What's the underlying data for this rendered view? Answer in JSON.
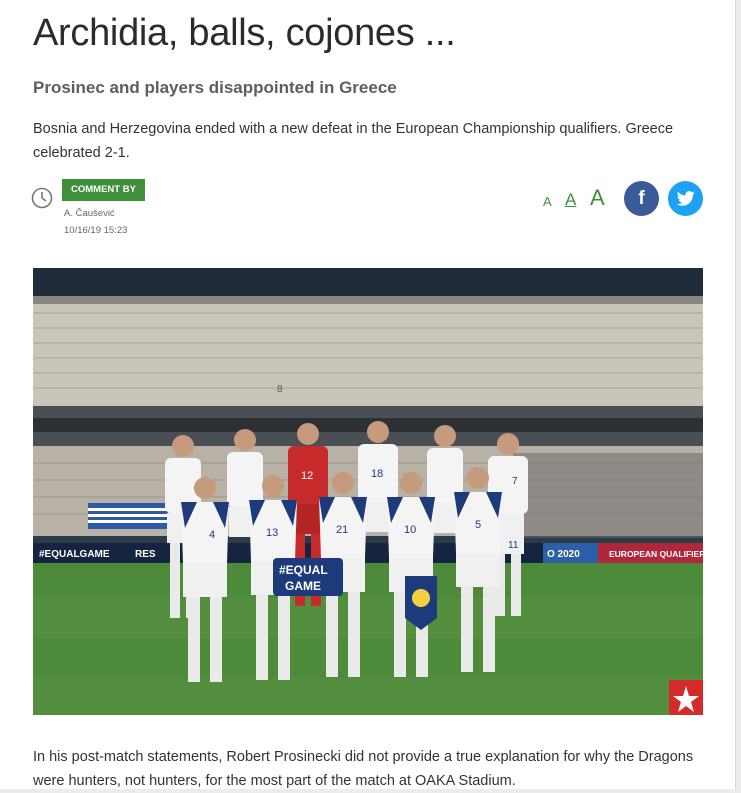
{
  "article": {
    "title": "Archidia, balls, cojones ...",
    "subtitle": "Prosinec and players disappointed in Greece",
    "lead": "Bosnia and Herzegovina ended with a new defeat in the European Championship qualifiers. Greece celebrated 2-1.",
    "comment_label": "COMMENT BY",
    "author": "A. Čaušević",
    "date": "10/16/19 15:23",
    "body": "In his post-match statements, Robert Prosinecki did not provide a true explanation for why the Dragons were hunters, not hunters, for the most part of the match at OAKA Stadium."
  },
  "font_controls": [
    "A",
    "A",
    "A"
  ],
  "social": {
    "facebook": "f",
    "twitter_icon": "twitter-icon"
  },
  "photo": {
    "ad_boards": [
      "#EQUALGAME",
      "RES",
      "O 2020",
      "EUROPEAN QUALIFIERS"
    ],
    "equal_game_sign": [
      "#EQUAL",
      "GAME"
    ],
    "numbers": [
      "8",
      "13",
      "21",
      "10",
      "5",
      "4",
      "18",
      "12",
      "7",
      "11"
    ]
  },
  "colors": {
    "accent_green": "#3f8f3b",
    "facebook": "#3b5a98",
    "twitter": "#1da1f2",
    "kit_white": "#f4f4f4",
    "kit_blue": "#1d3b7a",
    "keeper_red": "#c62a2a"
  }
}
